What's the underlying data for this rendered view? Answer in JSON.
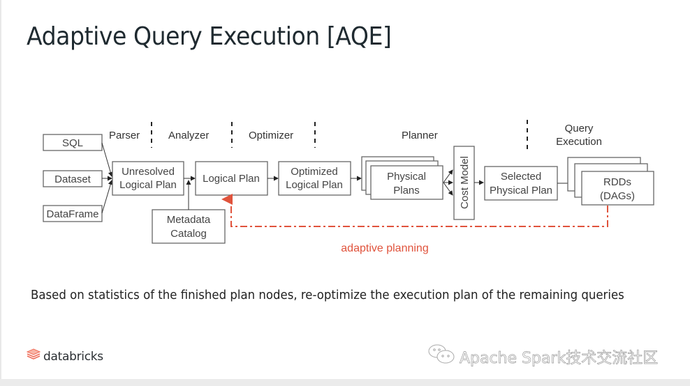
{
  "slide": {
    "title": "Adaptive Query Execution [AQE]",
    "description": "Based on statistics of the finished plan nodes, re-optimize the execution plan of the remaining queries"
  },
  "diagram": {
    "stages": {
      "parser": "Parser",
      "analyzer": "Analyzer",
      "optimizer": "Optimizer",
      "planner": "Planner",
      "query_execution_line1": "Query",
      "query_execution_line2": "Execution"
    },
    "inputs": [
      "SQL",
      "Dataset",
      "DataFrame"
    ],
    "nodes": {
      "unresolved_line1": "Unresolved",
      "unresolved_line2": "Logical Plan",
      "logical_plan": "Logical Plan",
      "metadata_line1": "Metadata",
      "metadata_line2": "Catalog",
      "optimized_line1": "Optimized",
      "optimized_line2": "Logical Plan",
      "physical_line1": "Physical",
      "physical_line2": "Plans",
      "cost_model": "Cost Model",
      "selected_line1": "Selected",
      "selected_line2": "Physical Plan",
      "rdds_line1": "RDDs",
      "rdds_line2": "(DAGs)"
    },
    "feedback_label": "adaptive planning",
    "feedback_color": "#e0533c"
  },
  "footer": {
    "logo_text": "databricks",
    "logo_color": "#ef6f5b",
    "watermark_icon": "wechat-icon",
    "watermark_text": "Apache Spark技术交流社区"
  }
}
